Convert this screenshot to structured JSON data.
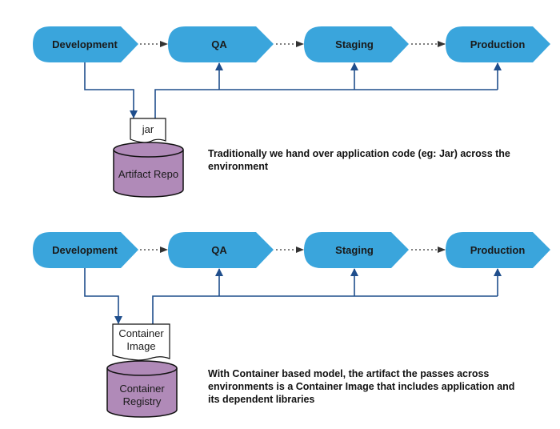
{
  "colors": {
    "stage_fill": "#3aa5dc",
    "connector": "#1f4e8c",
    "repo_fill": "#b08ab8",
    "doc_fill": "#ffffff",
    "dotted_arrow": "#333333"
  },
  "traditional": {
    "stages": [
      "Development",
      "QA",
      "Staging",
      "Production"
    ],
    "artifact_label": "jar",
    "repo_label": [
      "Artifact Repo"
    ],
    "caption": "Traditionally we hand over application code (eg: Jar) across the environment"
  },
  "container": {
    "stages": [
      "Development",
      "QA",
      "Staging",
      "Production"
    ],
    "artifact_label": [
      "Container",
      "Image"
    ],
    "repo_label": [
      "Container",
      "Registry"
    ],
    "caption": "With Container based model, the artifact the passes across environments is a Container Image that includes application and its dependent libraries"
  }
}
